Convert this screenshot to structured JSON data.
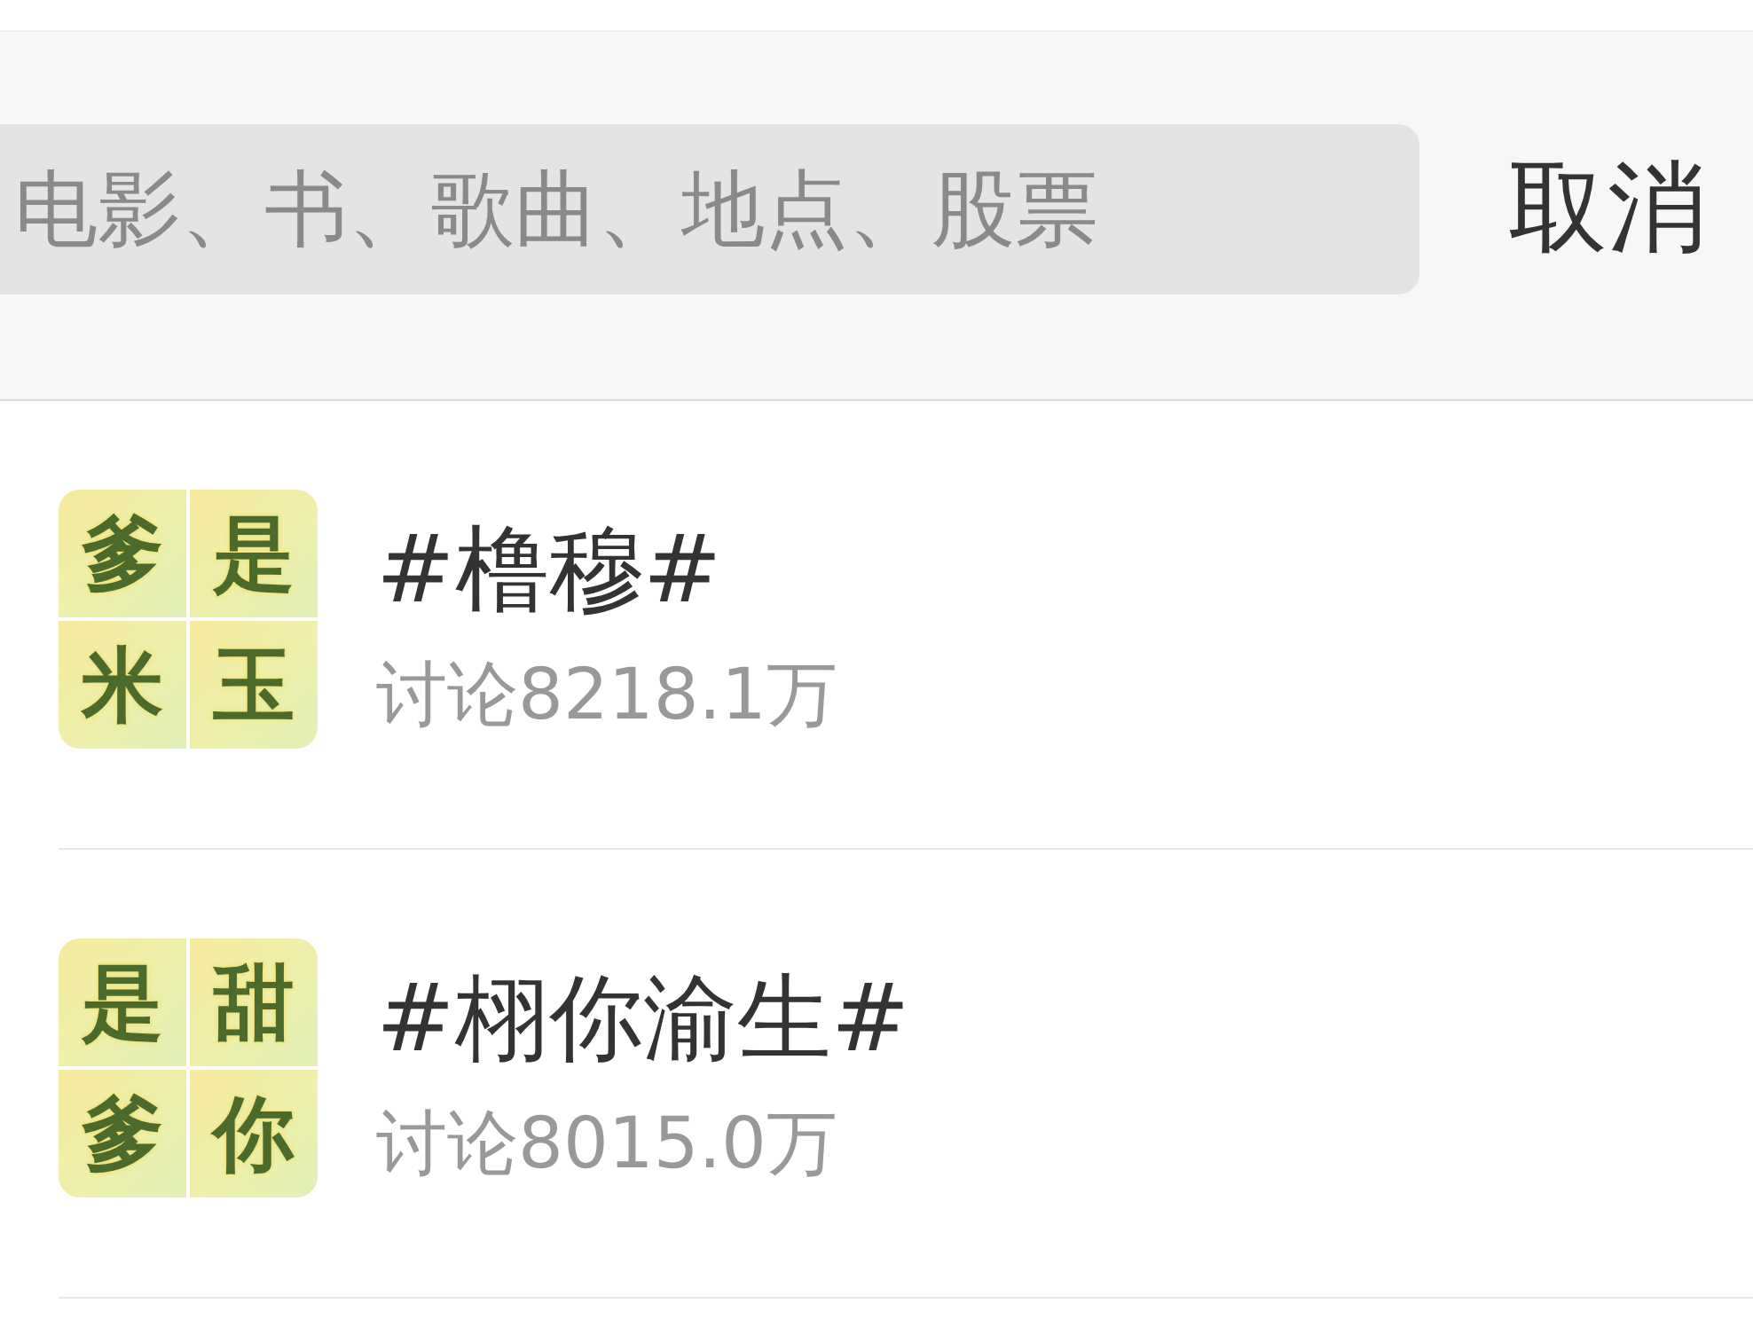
{
  "search": {
    "placeholder": "电影、书、歌曲、地点、股票"
  },
  "cancel_button": "取消",
  "results": [
    {
      "avatar_chars": [
        "爹",
        "是",
        "米",
        "玉"
      ],
      "title": "#橹穆#",
      "discussion": "讨论8218.1万"
    },
    {
      "avatar_chars": [
        "是",
        "甜",
        "爹",
        "你"
      ],
      "title": "#栩你渝生#",
      "discussion": "讨论8015.0万"
    }
  ]
}
